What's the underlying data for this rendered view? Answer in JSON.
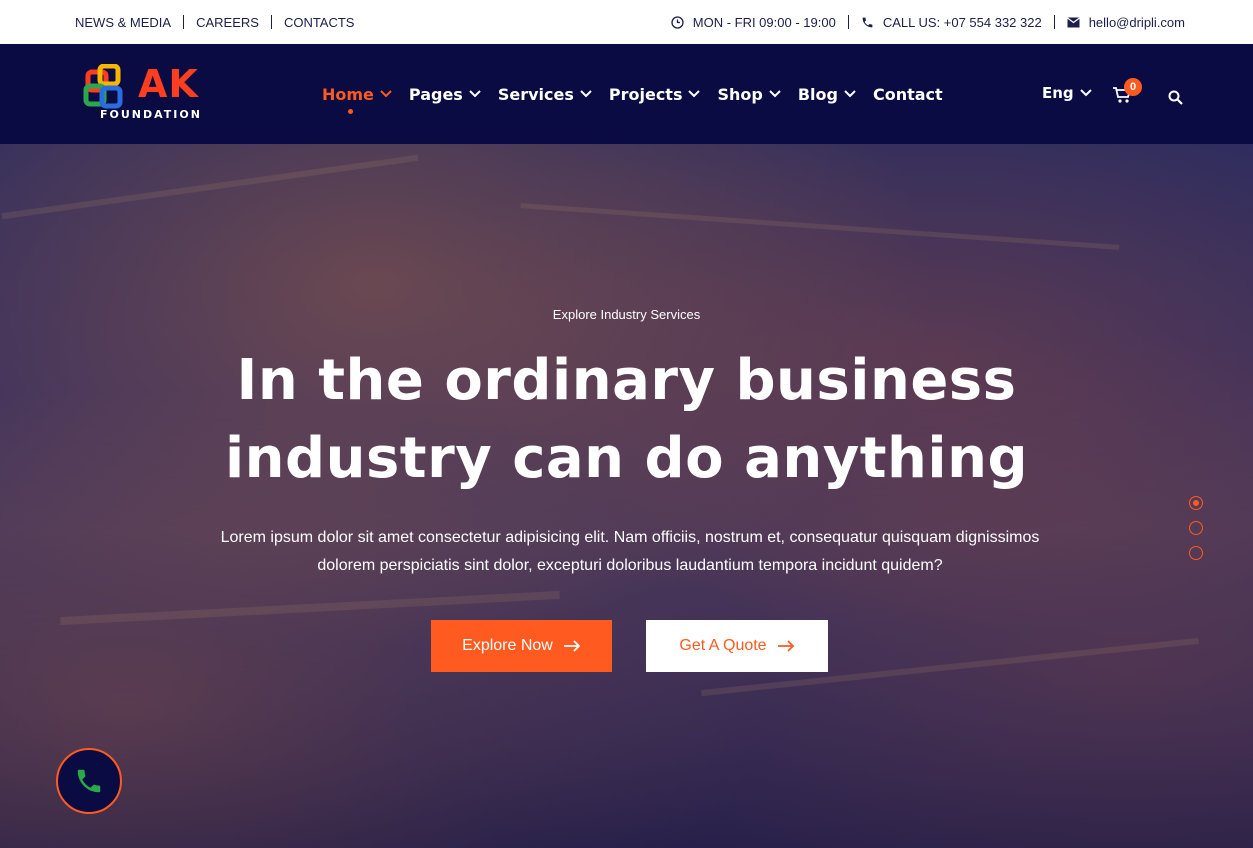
{
  "topbar": {
    "links": [
      "NEWS & MEDIA",
      "CAREERS",
      "CONTACTS"
    ],
    "hours": "MON - FRI 09:00 - 19:00",
    "phone": "CALL US: +07 554 332 322",
    "email": "hello@dripli.com"
  },
  "logo": {
    "text": "AK",
    "subtext": "FOUNDATION"
  },
  "nav": {
    "items": [
      {
        "label": "Home",
        "has_dropdown": true,
        "active": true
      },
      {
        "label": "Pages",
        "has_dropdown": true
      },
      {
        "label": "Services",
        "has_dropdown": true
      },
      {
        "label": "Projects",
        "has_dropdown": true
      },
      {
        "label": "Shop",
        "has_dropdown": true
      },
      {
        "label": "Blog",
        "has_dropdown": true
      },
      {
        "label": "Contact",
        "has_dropdown": false
      }
    ],
    "language": "Eng",
    "cart_count": "0"
  },
  "hero": {
    "eyebrow": "Explore Industry Services",
    "headline_line1": "In the ordinary business",
    "headline_line2": "industry can do anything",
    "subtext_line1": "Lorem ipsum dolor sit amet consectetur adipisicing elit. Nam officiis, nostrum et, consequatur quisquam dignissimos",
    "subtext_line2": "dolorem perspiciatis sint dolor, excepturi doloribus laudantium tempora incidunt quidem?",
    "primary_button": "Explore Now",
    "secondary_button": "Get A Quote"
  },
  "colors": {
    "accent": "#ff5a1f",
    "navy": "#0a0b42"
  },
  "icons": [
    "clock-icon",
    "phone-icon",
    "envelope-icon",
    "cart-icon",
    "search-icon",
    "arrow-right-icon",
    "chevron-down-icon"
  ]
}
